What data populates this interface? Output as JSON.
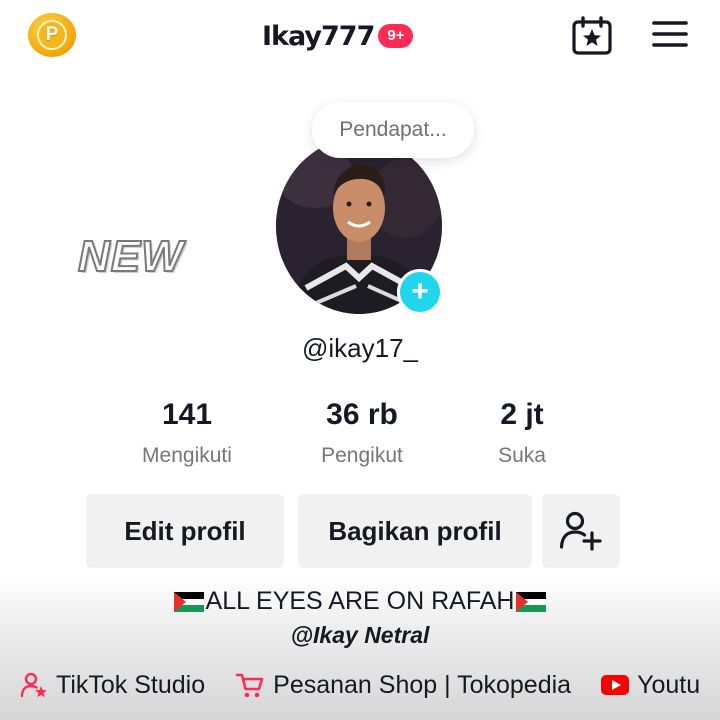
{
  "header": {
    "coin_letter": "P",
    "username": "Ikay777",
    "notification_badge": "9+"
  },
  "profile": {
    "status_bubble": "Pendapat...",
    "new_label": "NEW",
    "handle": "@ikay17_",
    "add_avatar_symbol": "+"
  },
  "stats": [
    {
      "value": "141",
      "label": "Mengikuti"
    },
    {
      "value": "36 rb",
      "label": "Pengikut"
    },
    {
      "value": "2 jt",
      "label": "Suka"
    }
  ],
  "buttons": {
    "edit": "Edit profil",
    "share": "Bagikan profil"
  },
  "bio": {
    "line1": "ALL EYES ARE ON RAFAH",
    "line2": "@Ikay Netral"
  },
  "links": [
    {
      "label": "TikTok Studio",
      "icon": "person-star-icon"
    },
    {
      "label": "Pesanan Shop | Tokopedia",
      "icon": "cart-icon"
    },
    {
      "label": "Youtu",
      "icon": "youtube-icon"
    }
  ],
  "colors": {
    "accent_pink": "#fe2c55",
    "accent_cyan": "#20d5ec",
    "text_primary": "#161823",
    "text_secondary": "#75767c",
    "button_bg": "#f1f1f2",
    "youtube_red": "#ff0000"
  }
}
